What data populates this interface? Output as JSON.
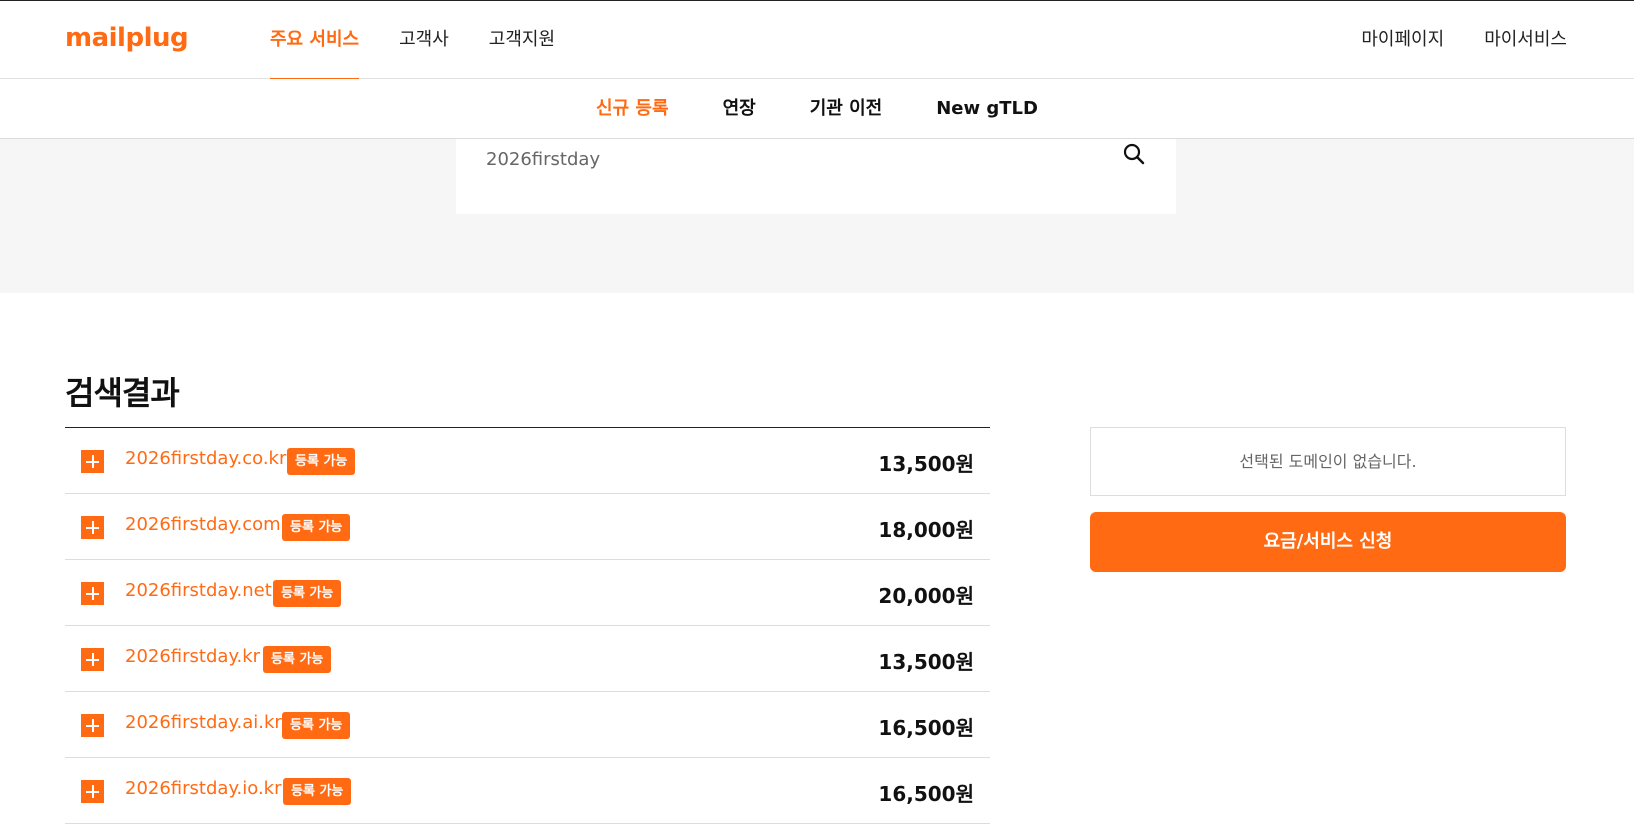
{
  "header": {
    "logo": "mailplug",
    "main_nav": [
      {
        "label": "주요 서비스",
        "active": true
      },
      {
        "label": "고객사",
        "active": false
      },
      {
        "label": "고객지원",
        "active": false
      }
    ],
    "user_nav": [
      {
        "label": "마이페이지"
      },
      {
        "label": "마이서비스"
      }
    ]
  },
  "sub_nav": [
    {
      "label": "신규 등록",
      "active": true
    },
    {
      "label": "연장",
      "active": false
    },
    {
      "label": "기관 이전",
      "active": false
    },
    {
      "label": "New gTLD",
      "active": false
    }
  ],
  "search": {
    "value": "2026firstday",
    "icon": "search-icon"
  },
  "results": {
    "title": "검색결과",
    "items": [
      {
        "domain": "2026firstday.co.kr",
        "status": "등록 가능",
        "price": "13,500원"
      },
      {
        "domain": "2026firstday.com",
        "status": "등록 가능",
        "price": "18,000원"
      },
      {
        "domain": "2026firstday.net",
        "status": "등록 가능",
        "price": "20,000원"
      },
      {
        "domain": "2026firstday.kr",
        "status": "등록 가능",
        "price": "13,500원"
      },
      {
        "domain": "2026firstday.ai.kr",
        "status": "등록 가능",
        "price": "16,500원"
      },
      {
        "domain": "2026firstday.io.kr",
        "status": "등록 가능",
        "price": "16,500원"
      }
    ]
  },
  "cart": {
    "empty_text": "선택된 도메인이 없습니다.",
    "apply_label": "요금/서비스 신청"
  },
  "colors": {
    "accent": "#ff6a13",
    "hero_bg": "#f6f6f6"
  }
}
